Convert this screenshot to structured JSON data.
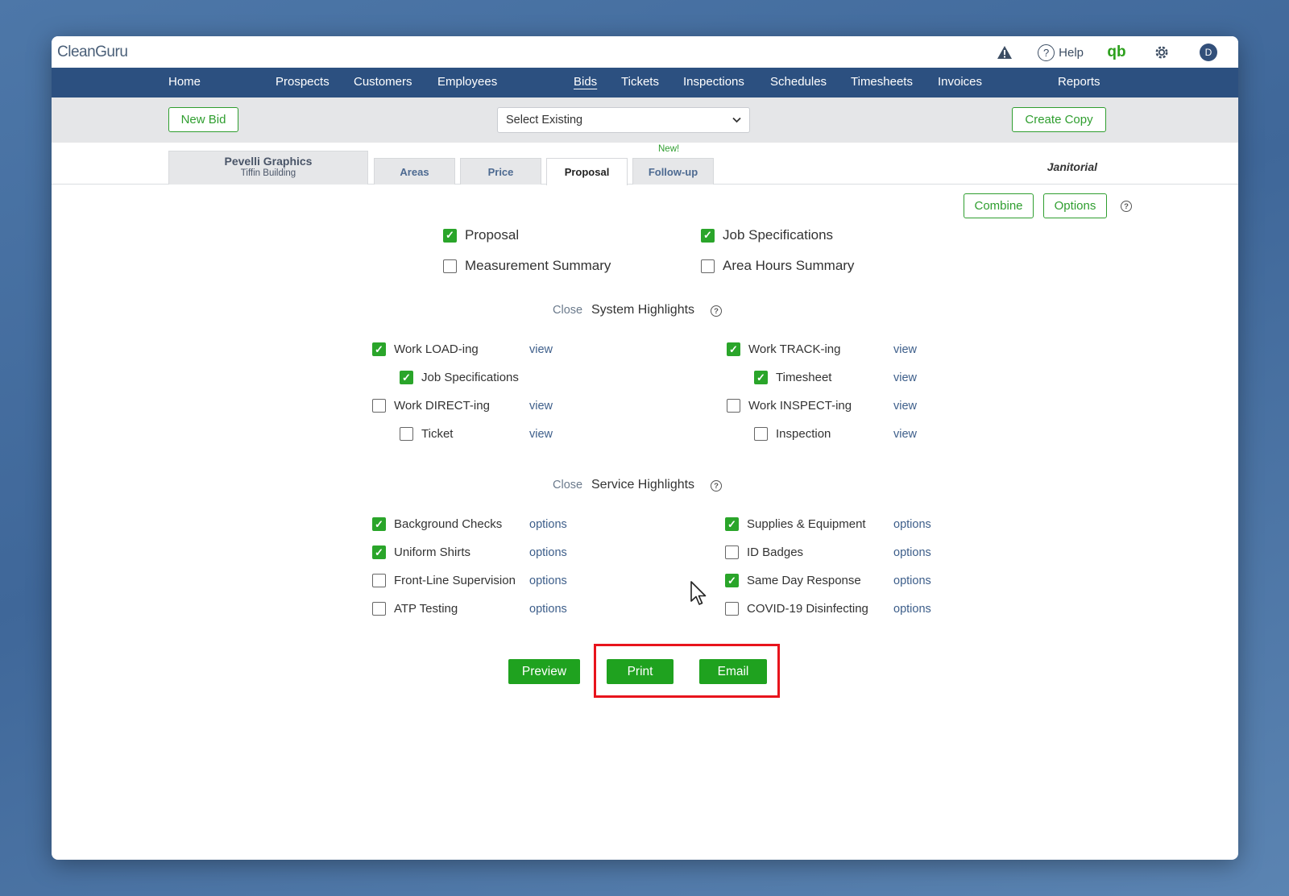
{
  "app": {
    "logo": "CleanGuru",
    "help_label": "Help",
    "qb_label": "qb",
    "avatar_initial": "D"
  },
  "nav": [
    "Home",
    "Prospects",
    "Customers",
    "Employees",
    "Bids",
    "Tickets",
    "Inspections",
    "Schedules",
    "Timesheets",
    "Invoices",
    "Reports"
  ],
  "nav_active": "Bids",
  "toolbar": {
    "new_bid": "New Bid",
    "select_value": "Select Existing",
    "create_copy": "Create Copy"
  },
  "client": {
    "name": "Pevelli Graphics",
    "building": "Tiffin Building"
  },
  "tabs": [
    "Areas",
    "Price",
    "Proposal",
    "Follow-up"
  ],
  "active_tab": "Proposal",
  "new_badge": "New!",
  "service_type": "Janitorial",
  "actions": {
    "combine": "Combine",
    "options": "Options"
  },
  "docs": [
    {
      "label": "Proposal",
      "checked": true
    },
    {
      "label": "Job Specifications",
      "checked": true
    },
    {
      "label": "Measurement Summary",
      "checked": false
    },
    {
      "label": "Area Hours Summary",
      "checked": false
    }
  ],
  "system_highlights": {
    "close": "Close",
    "title": "System Highlights",
    "left": [
      {
        "label": "Work LOAD-ing",
        "checked": true,
        "link": "view"
      },
      {
        "label": "Job Specifications",
        "checked": true,
        "link": ""
      },
      {
        "label": "Work DIRECT-ing",
        "checked": false,
        "link": "view"
      },
      {
        "label": "Ticket",
        "checked": false,
        "link": "view"
      }
    ],
    "right": [
      {
        "label": "Work TRACK-ing",
        "checked": true,
        "link": "view"
      },
      {
        "label": "Timesheet",
        "checked": true,
        "link": "view"
      },
      {
        "label": "Work INSPECT-ing",
        "checked": false,
        "link": "view"
      },
      {
        "label": "Inspection",
        "checked": false,
        "link": "view"
      }
    ]
  },
  "service_highlights": {
    "close": "Close",
    "title": "Service Highlights",
    "left": [
      {
        "label": "Background Checks",
        "checked": true,
        "link": "options"
      },
      {
        "label": "Uniform Shirts",
        "checked": true,
        "link": "options"
      },
      {
        "label": "Front-Line Supervision",
        "checked": false,
        "link": "options"
      },
      {
        "label": "ATP Testing",
        "checked": false,
        "link": "options"
      }
    ],
    "right": [
      {
        "label": "Supplies & Equipment",
        "checked": true,
        "link": "options"
      },
      {
        "label": "ID Badges",
        "checked": false,
        "link": "options"
      },
      {
        "label": "Same Day Response",
        "checked": true,
        "link": "options"
      },
      {
        "label": "COVID-19 Disinfecting",
        "checked": false,
        "link": "options"
      }
    ]
  },
  "buttons": {
    "preview": "Preview",
    "print": "Print",
    "email": "Email"
  },
  "colors": {
    "nav_bg": "#2c5080",
    "accent_green": "#1fa21f",
    "highlight_red": "#e8141c"
  }
}
